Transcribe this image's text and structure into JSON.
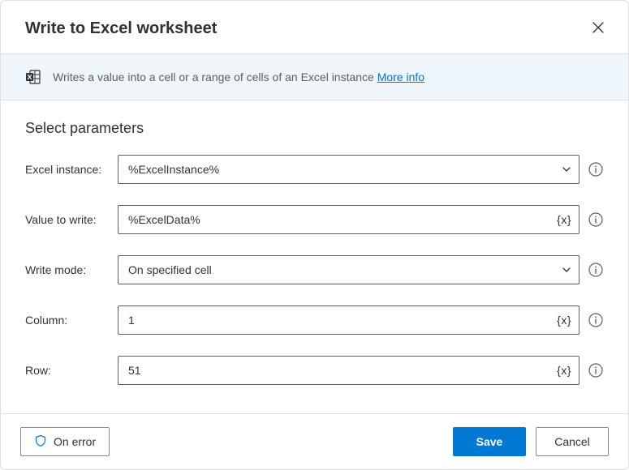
{
  "dialog": {
    "title": "Write to Excel worksheet",
    "description": "Writes a value into a cell or a range of cells of an Excel instance",
    "more_info": "More info",
    "section_title": "Select parameters"
  },
  "fields": {
    "excel_instance": {
      "label": "Excel instance:",
      "value": "%ExcelInstance%"
    },
    "value_to_write": {
      "label": "Value to write:",
      "value": "%ExcelData%"
    },
    "write_mode": {
      "label": "Write mode:",
      "value": "On specified cell"
    },
    "column": {
      "label": "Column:",
      "value": "1"
    },
    "row": {
      "label": "Row:",
      "value": "51"
    }
  },
  "footer": {
    "on_error": "On error",
    "save": "Save",
    "cancel": "Cancel"
  }
}
